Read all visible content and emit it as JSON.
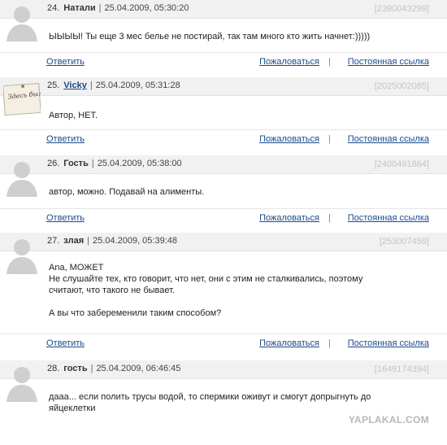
{
  "actions": {
    "reply": "Ответить",
    "report": "Пожаловаться",
    "separator": "|",
    "permalink": "Постоянная ссылка"
  },
  "comments": [
    {
      "num": "24.",
      "author": "Натали",
      "date": "25.04.2009, 05:30:20",
      "id": "[2390043299]",
      "lines": [
        "ЫЫЫЫ! Ты еще 3 мес белье не постирай, так там много кто жить начнет:)))))"
      ],
      "avatar": "default-avatar"
    },
    {
      "num": "25.",
      "author": "Vicky",
      "date": "25.04.2009, 05:31:28",
      "id": "[2025002085]",
      "lines": [
        "Автор, НЕТ."
      ],
      "avatar": "note-avatar",
      "avatar_text": "Здесь была Я."
    },
    {
      "num": "26.",
      "author": "Гость",
      "date": "25.04.2009, 05:38:00",
      "id": "[2400491864]",
      "lines": [
        "автор, можно. Подавай на алименты."
      ],
      "avatar": "default-avatar"
    },
    {
      "num": "27.",
      "author": "злая",
      "date": "25.04.2009, 05:39:48",
      "id": "[253007459]",
      "lines": [
        "Ana, МОЖЕТ",
        "Не слушайте тех, кто говорит, что нет, они с этим не сталкивались, поэтому",
        "считают, что такого не бывает.",
        "",
        "А вы что забеременили таким способом?"
      ],
      "avatar": "default-avatar"
    },
    {
      "num": "28.",
      "author": "гость",
      "date": "25.04.2009, 06:46:45",
      "id": "[1649174394]",
      "lines": [
        "дааа... если полить трусы водой, то спермики оживут и смогут допрыгнуть до",
        "яйцеклетки"
      ],
      "avatar": "default-avatar"
    }
  ],
  "watermark": "YAPLAKAL.COM"
}
